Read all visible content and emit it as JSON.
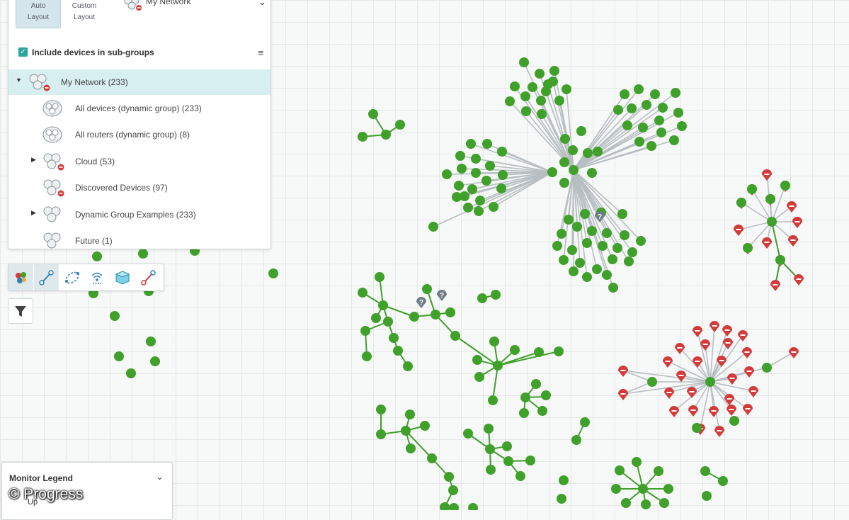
{
  "layout_panel": {
    "auto_label": "Auto\nLayout",
    "custom_label": "Custom\nLayout",
    "network_select": "My Network"
  },
  "include_subgroups": {
    "label": "Include devices in sub-groups",
    "checked": true
  },
  "tree": {
    "items": [
      {
        "label": "My Network (233)",
        "expanded": true,
        "selected": true,
        "icon": "device-group-down-icon"
      },
      {
        "label": "All devices (dynamic group) (233)",
        "icon": "dynamic-group-icon"
      },
      {
        "label": "All routers (dynamic group) (8)",
        "icon": "dynamic-group-icon"
      },
      {
        "label": "Cloud (53)",
        "expandable": true,
        "icon": "device-group-down-icon"
      },
      {
        "label": "Discovered Devices (97)",
        "icon": "device-group-down-icon"
      },
      {
        "label": "Dynamic Group Examples (233)",
        "expandable": true,
        "icon": "device-group-icon"
      },
      {
        "label": "Future (1)",
        "icon": "device-group-icon"
      }
    ]
  },
  "toolbar": {
    "buttons": [
      "device-status-icon",
      "connection-icon",
      "virtual-icon",
      "wireless-icon",
      "storage-icon",
      "link-icon"
    ]
  },
  "filter": {
    "icon": "filter-icon"
  },
  "legend": {
    "title": "Monitor Legend",
    "first_item": "Up"
  },
  "watermark": "© Progress",
  "colors": {
    "up": "#3fa02a",
    "down": "#d33a3a",
    "unknown": "#6d7d87",
    "link": "#b7bec2",
    "selected_row": "#d8eff2",
    "accent": "#2ba5a0"
  }
}
